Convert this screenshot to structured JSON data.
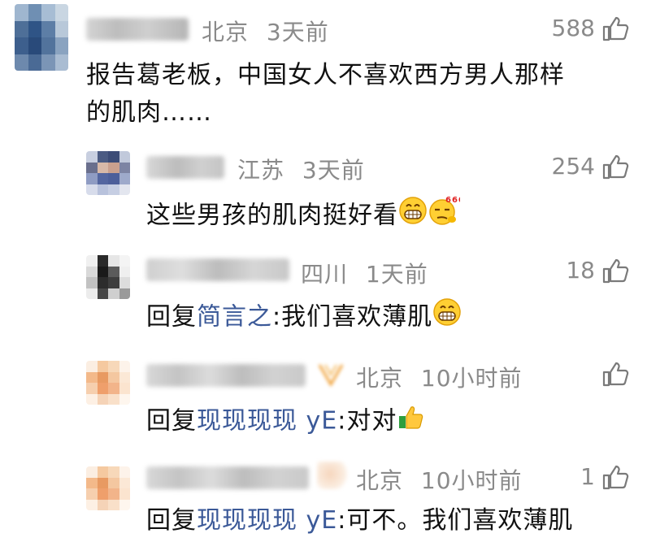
{
  "comments": [
    {
      "location": "北京",
      "time": "3天前",
      "likes": "588",
      "text": "报告葛老板，中国女人不喜欢西方男人那样",
      "text_line2": "的肌肉……"
    },
    {
      "location": "江苏",
      "time": "3天前",
      "likes": "254",
      "text": "这些男孩的肌肉挺好看"
    },
    {
      "location": "四川",
      "time": "1天前",
      "likes": "18",
      "reply_prefix": "回复",
      "reply_to": "简言之",
      "text": ":我们喜欢薄肌"
    },
    {
      "location": "北京",
      "time": "10小时前",
      "likes": "",
      "reply_prefix": "回复",
      "reply_to": "现现现现 yE",
      "text": ":对对"
    },
    {
      "location": "北京",
      "time": "10小时前",
      "likes": "1",
      "reply_prefix": "回复",
      "reply_to": "现现现现 yE",
      "text": ":可不。我们喜欢薄肌"
    }
  ],
  "colors": {
    "link": "#3b5998",
    "meta": "#8a8a8a",
    "text": "#111111"
  },
  "icons": {
    "like": "thumbs-up-outline-icon",
    "grin": "grinning-emoji-icon",
    "smirk": "smirk-666-emoji-icon",
    "thumb_emoji": "thumbs-up-emoji-icon"
  }
}
